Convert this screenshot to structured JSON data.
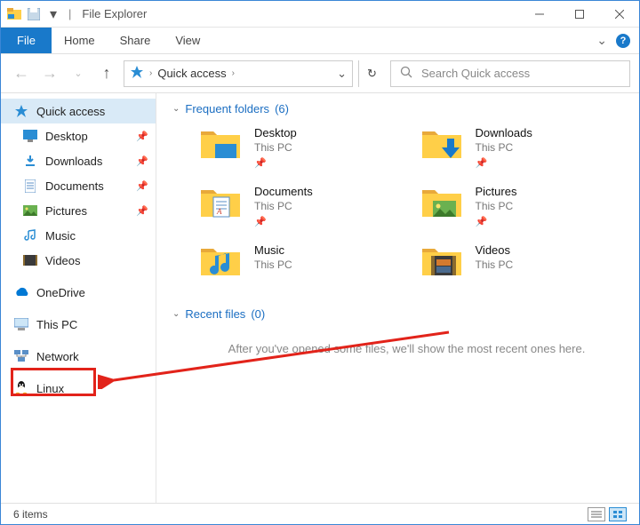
{
  "window": {
    "title": "File Explorer"
  },
  "ribbon": {
    "file": "File",
    "tabs": [
      "Home",
      "Share",
      "View"
    ]
  },
  "address": {
    "crumb": "Quick access"
  },
  "search": {
    "placeholder": "Search Quick access"
  },
  "sidebar": {
    "quick_access": "Quick access",
    "items": [
      {
        "label": "Desktop",
        "pinned": true
      },
      {
        "label": "Downloads",
        "pinned": true
      },
      {
        "label": "Documents",
        "pinned": true
      },
      {
        "label": "Pictures",
        "pinned": true
      },
      {
        "label": "Music",
        "pinned": false
      },
      {
        "label": "Videos",
        "pinned": false
      }
    ],
    "onedrive": "OneDrive",
    "this_pc": "This PC",
    "network": "Network",
    "linux": "Linux"
  },
  "sections": {
    "frequent": {
      "label": "Frequent folders",
      "count": "(6)"
    },
    "recent": {
      "label": "Recent files",
      "count": "(0)",
      "empty_msg": "After you've opened some files, we'll show the most recent ones here."
    }
  },
  "folders": [
    {
      "name": "Desktop",
      "loc": "This PC",
      "icon": "desktop"
    },
    {
      "name": "Downloads",
      "loc": "This PC",
      "icon": "downloads"
    },
    {
      "name": "Documents",
      "loc": "This PC",
      "icon": "documents"
    },
    {
      "name": "Pictures",
      "loc": "This PC",
      "icon": "pictures"
    },
    {
      "name": "Music",
      "loc": "This PC",
      "icon": "music"
    },
    {
      "name": "Videos",
      "loc": "This PC",
      "icon": "videos"
    }
  ],
  "status": {
    "items": "6 items"
  }
}
